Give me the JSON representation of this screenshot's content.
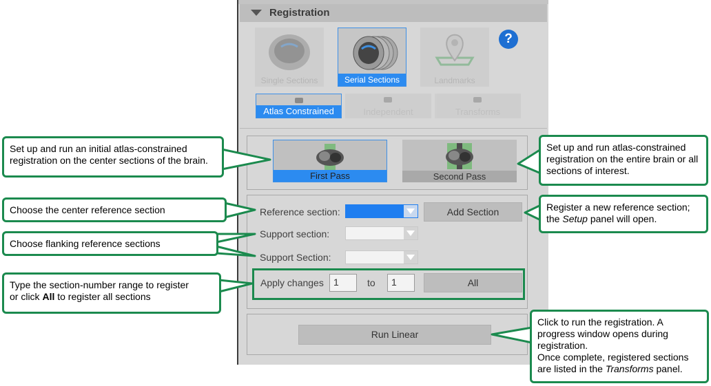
{
  "panel": {
    "title": "Registration",
    "help_label": "?",
    "modes": [
      {
        "label": "Single Sections",
        "state": "disabled"
      },
      {
        "label": "Serial Sections",
        "state": "selected"
      },
      {
        "label": "Landmarks",
        "state": "disabled"
      }
    ],
    "submodes": [
      {
        "label": "Atlas Constrained",
        "state": "selected"
      },
      {
        "label": "Independent",
        "state": "disabled"
      },
      {
        "label": "Transforms",
        "state": "disabled"
      }
    ],
    "passes": [
      {
        "label": "First Pass",
        "state": "selected"
      },
      {
        "label": "Second Pass",
        "state": "unselected"
      }
    ],
    "fields": {
      "reference_label": "Reference section:",
      "support1_label": "Support section:",
      "support2_label": "Support Section:",
      "apply_label": "Apply changes",
      "range_from": "1",
      "range_to_label": "to",
      "range_to": "1"
    },
    "buttons": {
      "add_section": "Add Section",
      "all": "All",
      "run_linear": "Run Linear"
    }
  },
  "callouts": {
    "first_pass": "Set up and run an initial atlas-constrained registration on the center sections of the brain.",
    "second_pass": "Set up and run atlas-constrained registration on the entire brain or all sections of interest.",
    "reference": "Choose the center reference section",
    "flanking": "Choose flanking reference sections",
    "range_line1": "Type the section-number range to register",
    "range_line2_pre": "or click ",
    "range_line2_bold": "All",
    "range_line2_post": " to register all sections",
    "add_pre": "Register a new reference section; the ",
    "add_em": "Setup",
    "add_post": " panel will open.",
    "run_line1": "Click to run the registration. A progress window opens during registration.",
    "run_line2_pre": "Once complete, registered sections are listed in the ",
    "run_line2_em": "Transforms",
    "run_line2_post": " panel."
  },
  "colors": {
    "accent_blue": "#2c8bf0",
    "callout_green": "#1b8a4e",
    "panel_gray": "#d7d7d7",
    "help_blue": "#1e6fd2"
  }
}
